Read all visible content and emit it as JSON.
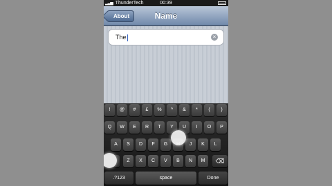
{
  "status_bar": {
    "carrier": "ThunderTech",
    "time": "00:39"
  },
  "nav_bar": {
    "back_label": "About",
    "title": "Name"
  },
  "text_field": {
    "value": "The"
  },
  "keyboard": {
    "row1": [
      "!",
      "@",
      "#",
      "£",
      "%",
      "^",
      "&",
      "*",
      "(",
      ")"
    ],
    "row2": [
      "Q",
      "W",
      "E",
      "R",
      "T",
      "Y",
      "U",
      "I",
      "O",
      "P"
    ],
    "row3": [
      "A",
      "S",
      "D",
      "F",
      "G",
      "H",
      "J",
      "K",
      "L"
    ],
    "row4": [
      "Z",
      "X",
      "C",
      "V",
      "B",
      "N",
      "M"
    ],
    "numbers_label": ".?123",
    "space_label": "space",
    "done_label": "Done"
  },
  "colors": {
    "nav_bar": "#6f88aa",
    "keyboard": "#1e1e1e",
    "caret": "#3a67c2"
  }
}
